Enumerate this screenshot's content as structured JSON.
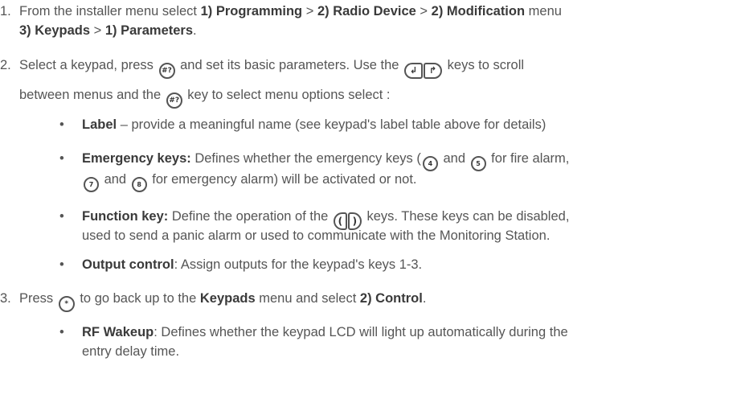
{
  "step1": {
    "num": "1.",
    "pre": "From the installer menu select ",
    "m1": "1) Programming",
    "sep1": " > ",
    "m2": "2) Radio Device",
    "sep2": " > ",
    "m3": "2) Modification",
    "post1": " menu",
    "m4": "3) Keypads",
    "sep3": " > ",
    "m5": "1) Parameters",
    "end": "."
  },
  "step2": {
    "num": "2.",
    "a": "Select a keypad, press ",
    "b": " and set its basic parameters. Use the ",
    "c": " keys to scroll",
    "d": "between menus and the ",
    "e": " key to select menu options select :"
  },
  "bullets2": {
    "label_title": "Label",
    "label_text": " – provide a meaningful name (see keypad's label table above for details)",
    "emerg_title": "Emergency keys:",
    "emerg_text1": " Defines whether the emergency keys (",
    "emerg_and1": " and ",
    "emerg_text2": " for fire alarm,",
    "emerg_and2": " and ",
    "emerg_text3": " for emergency alarm) will be activated or not.",
    "func_title": "Function key:",
    "func_text1": " Define the operation of the ",
    "func_text2": " keys. These keys can be disabled,",
    "func_text3": "used to send a panic alarm or used to communicate with the Monitoring Station.",
    "out_title": "Output control",
    "out_text": ": Assign outputs for the keypad's keys 1-3."
  },
  "step3": {
    "num": "3.",
    "a": "Press ",
    "b": " to go back up to the ",
    "c": "Keypads",
    "d": " menu and select ",
    "e": "2) Control",
    "f": ".",
    "rf_title": "RF Wakeup",
    "rf_text1": ": Defines whether the keypad LCD will light up automatically during the",
    "rf_text2": "entry delay time."
  },
  "keys": {
    "hash": "#?",
    "star": "*",
    "k4": "4",
    "k5": "5",
    "k7": "7",
    "k8": "8",
    "scroll_left": "↲",
    "scroll_right": "↱",
    "fn_left": "(",
    "fn_right": ")"
  },
  "bullet_char": "•"
}
